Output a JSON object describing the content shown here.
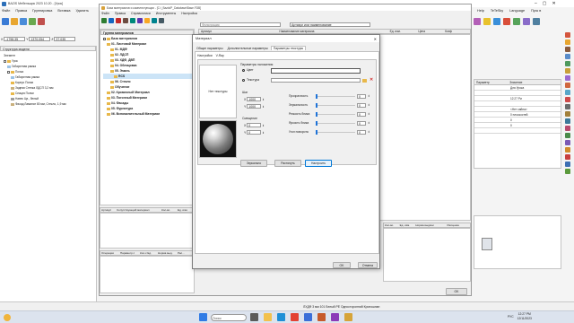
{
  "window": {
    "left_title": "BAZIS Мебельщик 2023 10.20 - [Урок]",
    "left_menu": [
      "Файл",
      "Правка",
      "Группировка",
      "Вставка",
      "Удалить"
    ],
    "editor_title": "База материалов и комплектующих - [C:\\_Bazis\\P_Database\\Base.FDB]",
    "editor_menu": [
      "Файл",
      "Правка",
      "Справочники",
      "Инструменты",
      "Настройка"
    ],
    "status_text": "ЛХДФ 3 мм 101 Белый РЕ Односторонний Кроношпан",
    "right_menu": [
      "Help",
      "TeTeSky",
      "Language",
      "Пуск в"
    ]
  },
  "coords": {
    "x": "-1798.35",
    "y": "1370.054",
    "z": "37.035"
  },
  "model_panel": {
    "title": "Структура модели",
    "items": [
      "Элемент",
      "Урок",
      "Габаритная рамка",
      "Полка",
      "Габаритная рамка",
      "Корпус Полки",
      "Задняя Стенка ЛДСП 3,2 мм",
      "Секция Полки",
      "Навес Цв., белый",
      "Фасад Ламинат 80 мм, Стекло, 1,9 мм"
    ]
  },
  "material_panel": {
    "title": "Группа материалов",
    "items": [
      "База материалов",
      "01. Листовой Материал",
      "01. МДФ",
      "02. ЛДСП",
      "03. ХДФ, ДВП",
      "04. Облицовка",
      "05. Эмаль",
      "RCS",
      "06. Стекло",
      "Обучение",
      "02. Кромочный Материал",
      "03. Погонный Материал",
      "04. Фасады",
      "05. Фурнитура",
      "06. Вспомогательный Материал"
    ]
  },
  "bottom_tabs": [
    "Артикул",
    "Сопутствующий материал",
    "Кол-во",
    "Ед. изм."
  ],
  "ops_tabs": [
    "Операции",
    "Параметр с",
    "Кол-с Ед.",
    "Норма выд.",
    "Рас..."
  ],
  "editor_toolbar": {
    "search_placeholder": "Фильтрация",
    "name_filter": "Артикул или наименование"
  },
  "grid_headers": [
    "Артикул",
    "Наименование материала",
    "Ед. изм.",
    "Цена",
    "Коэф"
  ],
  "right_table": {
    "headers": [
      "Параметр",
      "Значение"
    ],
    "rows": [
      {
        "label": "",
        "value": "Для Урока"
      },
      {
        "label": "",
        "value": ""
      },
      {
        "label": "",
        "value": "12.27 Ри"
      },
      {
        "label": "",
        "value": ""
      },
      {
        "label": "",
        "value": "<Нет сайна>"
      },
      {
        "label": "",
        "value": "0 плоскостей"
      },
      {
        "label": "",
        "value": "0"
      },
      {
        "label": "",
        "value": "0"
      },
      {
        "label": "",
        "value": ""
      }
    ]
  },
  "right_bottom_cols": [
    "Кол-во",
    "Ед. изм.",
    "Норма выдачи",
    "Расценка"
  ],
  "dialog": {
    "title": "Материал",
    "tabs": [
      "Общие параметры",
      "Дополнительные параметры",
      "Параметры текстуры"
    ],
    "sub_tabs": [
      "Настройки",
      "V-Ray"
    ],
    "no_texture": "Нет текстуры",
    "fill_group": "Параметры наложения",
    "color_label": "Цвет",
    "texture_label": "Текстура",
    "step_group": "Шаг",
    "offset_group": "Смещение",
    "step_x_label": "X",
    "step_x": "1000",
    "step_y_label": "Y",
    "step_y": "1000",
    "off_x_label": "X",
    "off_x": "0",
    "off_y_label": "Y",
    "off_y": "0",
    "props": [
      {
        "label": "Прозрачность",
        "value": "0"
      },
      {
        "label": "Зеркальность",
        "value": "0"
      },
      {
        "label": "Резкость блика",
        "value": "0"
      },
      {
        "label": "Яркость блика",
        "value": "0"
      },
      {
        "label": "Угол поворота",
        "value": "0"
      }
    ],
    "btn_mirror": "Зеркально",
    "btn_stretch": "Растянуть",
    "btn_setup": "Настроить",
    "ok": "OK",
    "cancel": "Отмена"
  },
  "editor_ok": "OK",
  "taskbar": {
    "search": "Поиск",
    "time": "12:27 PM",
    "date": "12/11/2023",
    "lang": "РУС"
  },
  "sidebar_labels": [
    "Разрез",
    "Развертка",
    "Чертеж"
  ]
}
